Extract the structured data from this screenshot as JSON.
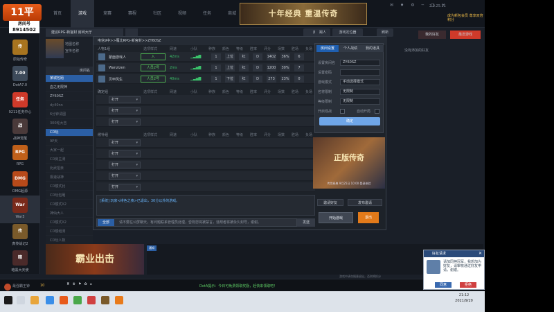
{
  "app": {
    "logo_text": "11平",
    "room_id_label": "房间号",
    "room_id_value": "8914502",
    "nav_tabs": [
      "首页",
      "游戏",
      "竞赛",
      "赛程",
      "社区",
      "视频",
      "任务",
      "商城"
    ],
    "active_nav": "游戏",
    "banner_text": "十年经典 重温传奇",
    "top_icons": "✉ ♦ ⚙ ─ □ ✕",
    "version": "2.0.25.21",
    "promo_text": "成为新包会员 尊享双倍积分"
  },
  "sidebar": {
    "items": [
      {
        "label": "原始传奇",
        "icon": "传",
        "color": "#a8741f"
      },
      {
        "label": "DotA7.0",
        "icon": "7.00",
        "color": "#3d4a5a"
      },
      {
        "label": "9211任务中心",
        "icon": "任务",
        "color": "#d03a2a"
      },
      {
        "label": "战神觉醒",
        "icon": "战",
        "color": "#4a3a3a"
      },
      {
        "label": "RPG",
        "icon": "RPG",
        "color": "#c0601a"
      },
      {
        "label": "DMG起源",
        "icon": "DMG",
        "color": "#b84a1a"
      },
      {
        "label": "War3",
        "icon": "War",
        "color": "#7a2a1a"
      },
      {
        "label": "真传战记2",
        "icon": "传",
        "color": "#7a5a2a"
      },
      {
        "label": "暗黑大天使",
        "icon": "暗",
        "color": "#4a2a2a"
      }
    ],
    "active": "War3"
  },
  "lobby": {
    "tab_label": "建议RPG-新官封 房间大厅",
    "buttons": [
      "房间",
      "踢人",
      "游戏定位器",
      "刷新"
    ],
    "map_label": "地图名称",
    "map_author": "宣传名称",
    "list_header": "房间名",
    "list_rows": [
      {
        "name": "某城包厢",
        "style": "hl"
      },
      {
        "name": "血之无限神",
        "style": "br"
      },
      {
        "name": "ZY60SZ",
        "style": "br"
      },
      {
        "name": "dy40nn",
        "style": ""
      },
      {
        "name": "6分钟清图",
        "style": ""
      },
      {
        "name": "300轮大吉",
        "style": ""
      },
      {
        "name": "CD玩",
        "style": "hl"
      },
      {
        "name": "9P天",
        "style": ""
      },
      {
        "name": "大家一起",
        "style": ""
      },
      {
        "name": "CD房主测",
        "style": ""
      },
      {
        "name": "比武招亲",
        "style": ""
      },
      {
        "name": "极速战神",
        "style": ""
      },
      {
        "name": "CD模式比",
        "style": ""
      },
      {
        "name": "CD玩包厢",
        "style": ""
      },
      {
        "name": "CD模式X2",
        "style": ""
      },
      {
        "name": "神仙大人",
        "style": ""
      },
      {
        "name": "CD模式X2",
        "style": ""
      },
      {
        "name": "CD模组测",
        "style": ""
      },
      {
        "name": "CD玩人数",
        "style": ""
      }
    ]
  },
  "room": {
    "title": "电信9中>>雁北RPG-新官封>>ZY60SZ",
    "section1": "人物1组",
    "section2": "确定组",
    "section3": "候补组",
    "columns": [
      "选项样式",
      "网速",
      "小队",
      "种族",
      "颜色",
      "等级",
      "胜率",
      "评分",
      "场数",
      "胜场",
      "负场"
    ],
    "players": [
      {
        "name": "蒙面游戏人",
        "state": "入",
        "ping": "42ms",
        "bars": "▁▃▅▇",
        "cells": [
          "1",
          "上位",
          "红",
          "D",
          "1402",
          "36%",
          "6"
        ]
      },
      {
        "name": "Wanzizen",
        "state": "人员2号",
        "ping": "2ms",
        "bars": "▁▃▅▇",
        "cells": [
          "1",
          "上位",
          "红",
          "D",
          "1200",
          "30%",
          "7"
        ]
      },
      {
        "name": "贝甲风生",
        "state": "人员2号",
        "ping": "40ms",
        "bars": "▁▃▅▇",
        "cells": [
          "1",
          "下位",
          "红",
          "D",
          "273",
          "23%",
          "0"
        ]
      }
    ],
    "open_label": "打开",
    "chat_line": "[系统] 玩家<绯色之夜>已退出，30分以外的游戏。",
    "chat_channel": "全部",
    "chat_placeholder": "请不要在公屏聊天，有问题联系管理员处理，否则您将被禁言，违规者将被永久封号，谢谢。",
    "send_label": "发送"
  },
  "settings": {
    "tabs": [
      "房间设置",
      "个人战绩",
      "我的道具"
    ],
    "rows": [
      {
        "label": "设置房间名",
        "value": "ZY60SZ"
      },
      {
        "label": "设置密码",
        "value": ""
      },
      {
        "label": "游戏模式",
        "value": "手动选择模式"
      },
      {
        "label": "名将限制",
        "value": "无限制"
      },
      {
        "label": "等级限制",
        "value": "无限制"
      }
    ],
    "checkbox1": "开启观战",
    "checkbox2": "自动开局",
    "confirm": "确定"
  },
  "room_side": {
    "ad_title": "正版传奇",
    "ad_caption": "传世经典 9月25日 10:00 登录体验",
    "btn1": "邀请好友",
    "btn2": "发布邀请",
    "start": "开始游戏",
    "exit": "退出"
  },
  "friends": {
    "btn1": "我的好友",
    "btn2": "最近游戏",
    "empty": "没有添加的好友"
  },
  "bottom": {
    "ad_text": "霸业出击",
    "tag": "通知",
    "note": "游戏中请勿随意退出，否则将扣分",
    "user": "最强霸王钟",
    "level": "10",
    "status_msg": "DotA提示：今日可免费领取奖励，赶快来领取吧！"
  },
  "taskbar": {
    "time": "21:12",
    "date": "2021/9/20"
  },
  "popup": {
    "title": "好友请求",
    "body": "请加同神冠军，我想加为好友，请审核通过好友申请，谢谢。",
    "agree": "同意",
    "reject": "拒绝"
  }
}
